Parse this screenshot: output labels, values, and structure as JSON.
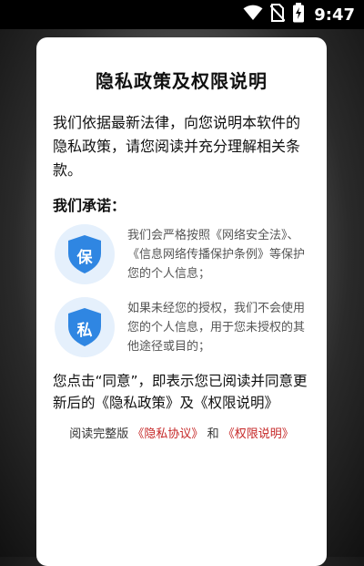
{
  "status_bar": {
    "time": "9:47",
    "icons": [
      "wifi-icon",
      "no-sim-icon",
      "battery-charging-icon"
    ]
  },
  "dialog": {
    "title": "隐私政策及权限说明",
    "intro": "我们依据最新法律，向您说明本软件的隐私政策，请您阅读并充分理解相关条款。",
    "promise_heading": "我们承诺：",
    "promises": [
      {
        "icon": "shield-icon",
        "icon_char": "保",
        "text": "我们会严格按照《网络安全法》、《信息网络传播保护条例》等保护您的个人信息；"
      },
      {
        "icon": "shield-icon",
        "icon_char": "私",
        "text": "如果未经您的授权，我们不会使用您的个人信息，用于您未授权的其他途径或目的；"
      }
    ],
    "consent": "您点击“同意”，即表示您已阅读并同意更新后的《隐私政策》及《权限说明》",
    "links": {
      "prefix": "阅读完整版",
      "privacy_link": "《隐私协议》",
      "and": "和",
      "permission_link": "《权限说明》"
    }
  },
  "colors": {
    "shield": "#2f86e2",
    "shield_bg": "#e5f0fc",
    "link": "#c62828"
  }
}
